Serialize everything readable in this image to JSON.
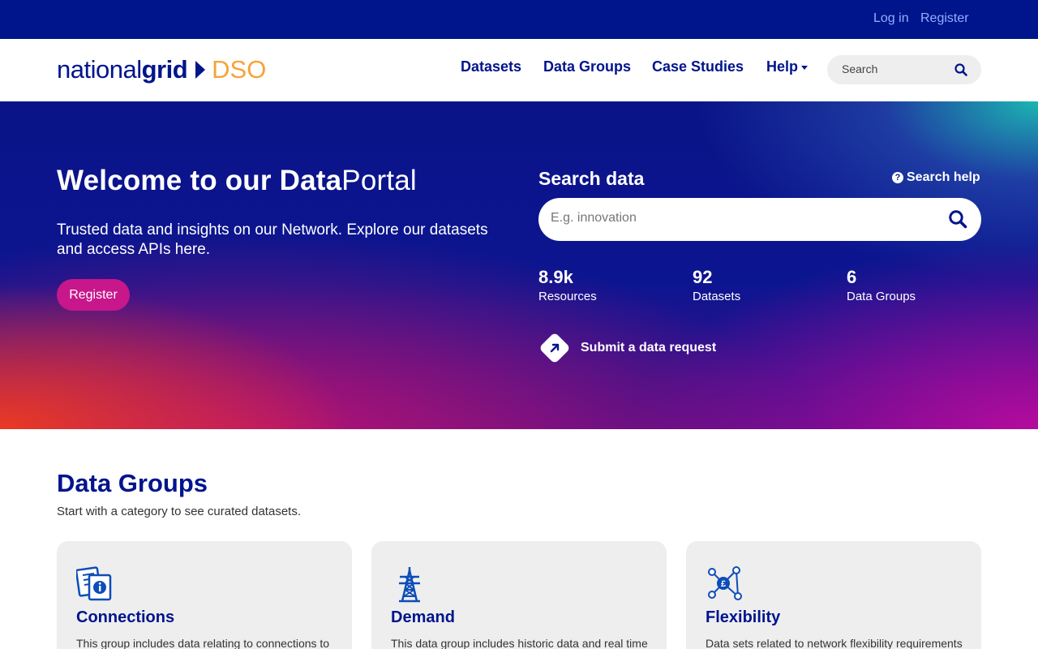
{
  "topbar": {
    "login": "Log in",
    "register": "Register"
  },
  "header": {
    "logo": {
      "part1": "national",
      "part2": "grid",
      "part3": "DSO"
    },
    "nav": [
      "Datasets",
      "Data Groups",
      "Case Studies",
      "Help"
    ],
    "search_placeholder": "Search"
  },
  "hero": {
    "title_bold": "Welcome to our Data",
    "title_light": "Portal",
    "lead": "Trusted data and insights on our Network. Explore our datasets and access APIs here.",
    "register_label": "Register",
    "search_title": "Search data",
    "search_help": "Search help",
    "search_placeholder": "E.g. innovation",
    "stats": [
      {
        "value": "8.9k",
        "label": "Resources"
      },
      {
        "value": "92",
        "label": "Datasets"
      },
      {
        "value": "6",
        "label": "Data Groups"
      }
    ],
    "request_label": "Submit a data request"
  },
  "data_groups": {
    "title": "Data Groups",
    "subtitle": "Start with a category to see curated datasets.",
    "cards": [
      {
        "title": "Connections",
        "desc": "This group includes data relating to connections to",
        "icon": "documents-info-icon"
      },
      {
        "title": "Demand",
        "desc": "This data group includes historic data and real time",
        "icon": "pylon-icon"
      },
      {
        "title": "Flexibility",
        "desc": "Data sets related to network flexibility requirements",
        "icon": "flexibility-network-icon"
      }
    ]
  },
  "colors": {
    "navy": "#00148c",
    "magenta": "#c8168b",
    "orange": "#f7a23a",
    "card_bg": "#eeeeee"
  }
}
